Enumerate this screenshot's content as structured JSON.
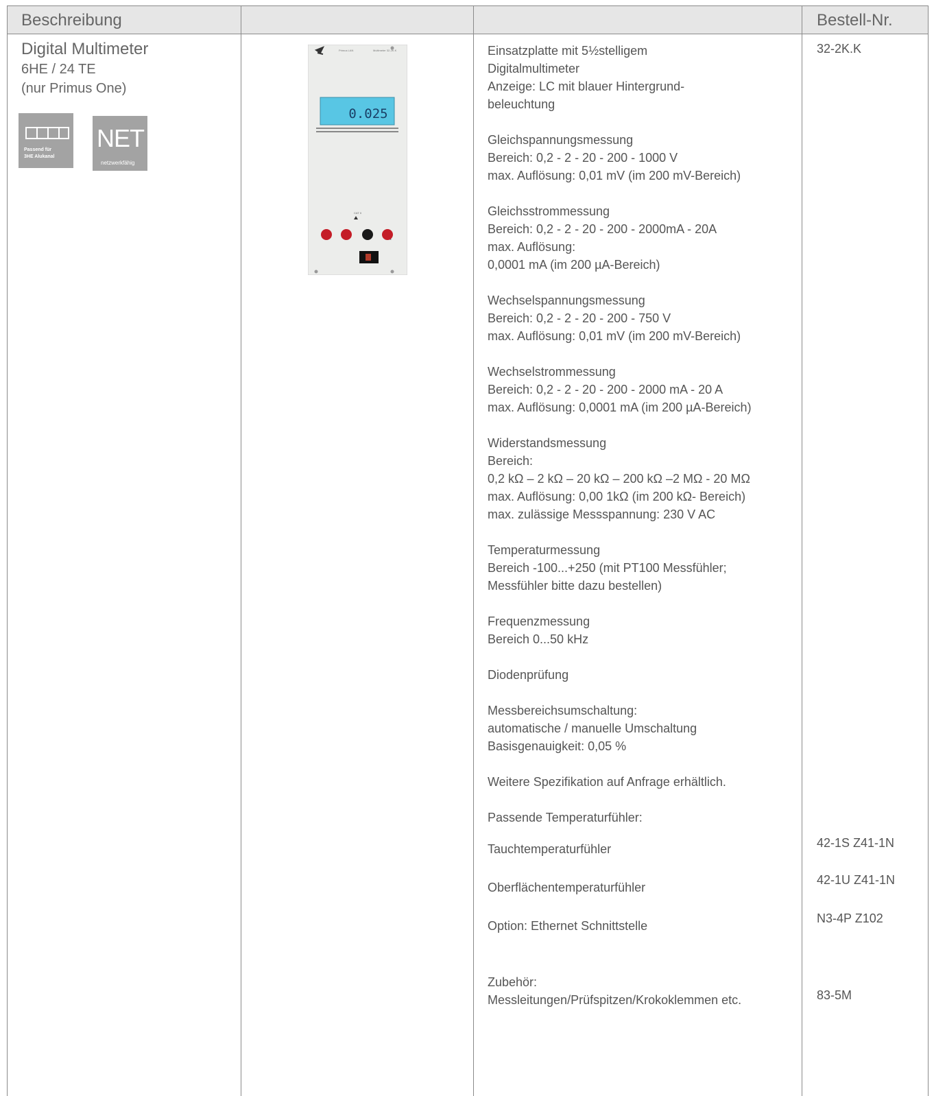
{
  "header": {
    "description": "Beschreibung",
    "order_no": "Bestell-Nr."
  },
  "product": {
    "title": "Digital Multimeter",
    "size": "6HE / 24 TE",
    "note": "(nur Primus One)"
  },
  "badges": {
    "rail_line1": "Passend für",
    "rail_line2": "3HE Alukanal",
    "net_title": "NET",
    "net_sub": "netzwerkfähig"
  },
  "device": {
    "display_value": "0.025",
    "brand_left": "Primus LAN",
    "brand_right": "Multimeter 32-2K.K"
  },
  "spec_blocks": [
    [
      "Einsatzplatte mit 5½stelligem",
      "Digitalmultimeter",
      "Anzeige: LC mit blauer Hintergrund-",
      "beleuchtung"
    ],
    [
      "Gleichspannungsmessung",
      "Bereich:   0,2 - 2 - 20 - 200 - 1000 V",
      "max. Auflösung:   0,01 mV (im 200 mV-Bereich)"
    ],
    [
      "Gleichsstrommessung",
      "Bereich:   0,2 - 2 - 20 - 200 - 2000mA - 20A",
      "max. Auflösung:",
      "0,0001 mA (im 200 µA-Bereich)"
    ],
    [
      "Wechselspannungsmessung",
      "Bereich:   0,2 - 2 - 20 - 200 - 750 V",
      "max. Auflösung:   0,01 mV (im 200 mV-Bereich)"
    ],
    [
      "Wechselstrommessung",
      "Bereich:   0,2 - 2 - 20 - 200 - 2000 mA - 20 A",
      "max. Auflösung:   0,0001 mA (im 200 µA-Bereich)"
    ],
    [
      "Widerstandsmessung",
      "Bereich:",
      "0,2 kΩ – 2 kΩ – 20 kΩ – 200 kΩ –2 MΩ - 20 MΩ",
      "max. Auflösung:   0,00 1kΩ (im 200 kΩ- Bereich)",
      "max. zulässige Messspannung: 230 V AC"
    ],
    [
      "Temperaturmessung",
      "Bereich   -100...+250 (mit PT100 Messfühler;",
      "Messfühler bitte dazu bestellen)"
    ],
    [
      "Frequenzmessung",
      "Bereich   0...50 kHz"
    ],
    [
      "Diodenprüfung"
    ],
    [
      "Messbereichsumschaltung:",
      "automatische / manuelle Umschaltung",
      "Basisgenauigkeit:   0,05 %"
    ],
    [
      "Weitere Spezifikation auf Anfrage erhältlich."
    ]
  ],
  "accessories": {
    "temp_sensors_heading": "Passende Temperaturfühler:",
    "items": [
      {
        "label": "Tauchtemperaturfühler",
        "order": "42-1S Z41-1N"
      },
      {
        "label": "Oberflächentemperaturfühler",
        "order": "42-1U Z41-1N"
      },
      {
        "label": "Option: Ethernet Schnittstelle",
        "order": "N3-4P Z102"
      }
    ],
    "zubehoer_heading": "Zubehör:",
    "zubehoer_label": "Messleitungen/Prüfspitzen/Krokoklemmen etc.",
    "zubehoer_order": "83-5M"
  },
  "main_order_no": "32-2K.K"
}
